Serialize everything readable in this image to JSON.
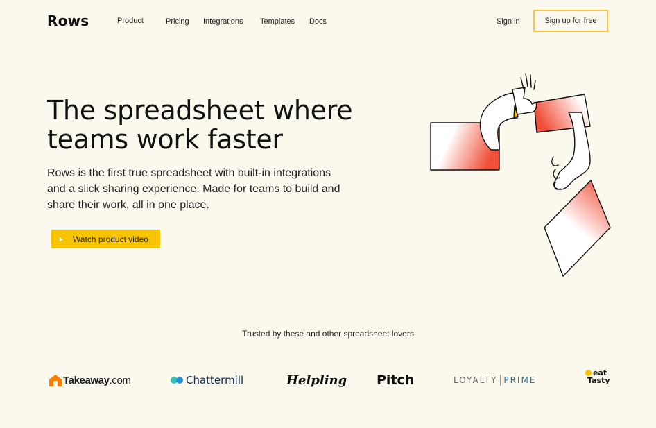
{
  "nav": {
    "logo": "Rows",
    "links": [
      "Product",
      "Pricing",
      "Integrations",
      "Templates",
      "Docs"
    ],
    "signin": "Sign in",
    "signup": "Sign up for free"
  },
  "hero": {
    "title": "The spreadsheet where teams work faster",
    "subtitle": "Rows is the first true spreadsheet with built-in integrations and a slick sharing experience. Made for teams to build and share their work, all in one place.",
    "cta": "Watch product video"
  },
  "trusted": {
    "heading": "Trusted by these and other spreadsheet lovers",
    "brands": {
      "takeaway_main": "Takeaway",
      "takeaway_suffix": ".com",
      "chattermill": "Chattermill",
      "helpling": "Helpling",
      "pitch": "Pitch",
      "loyalty": "LOYALTY",
      "prime": "PRIME",
      "eat": "eat",
      "tasty": "Tasty"
    }
  },
  "colors": {
    "background": "#fbf8ee",
    "accent_yellow": "#f7c400",
    "accent_red": "#f0503a"
  }
}
